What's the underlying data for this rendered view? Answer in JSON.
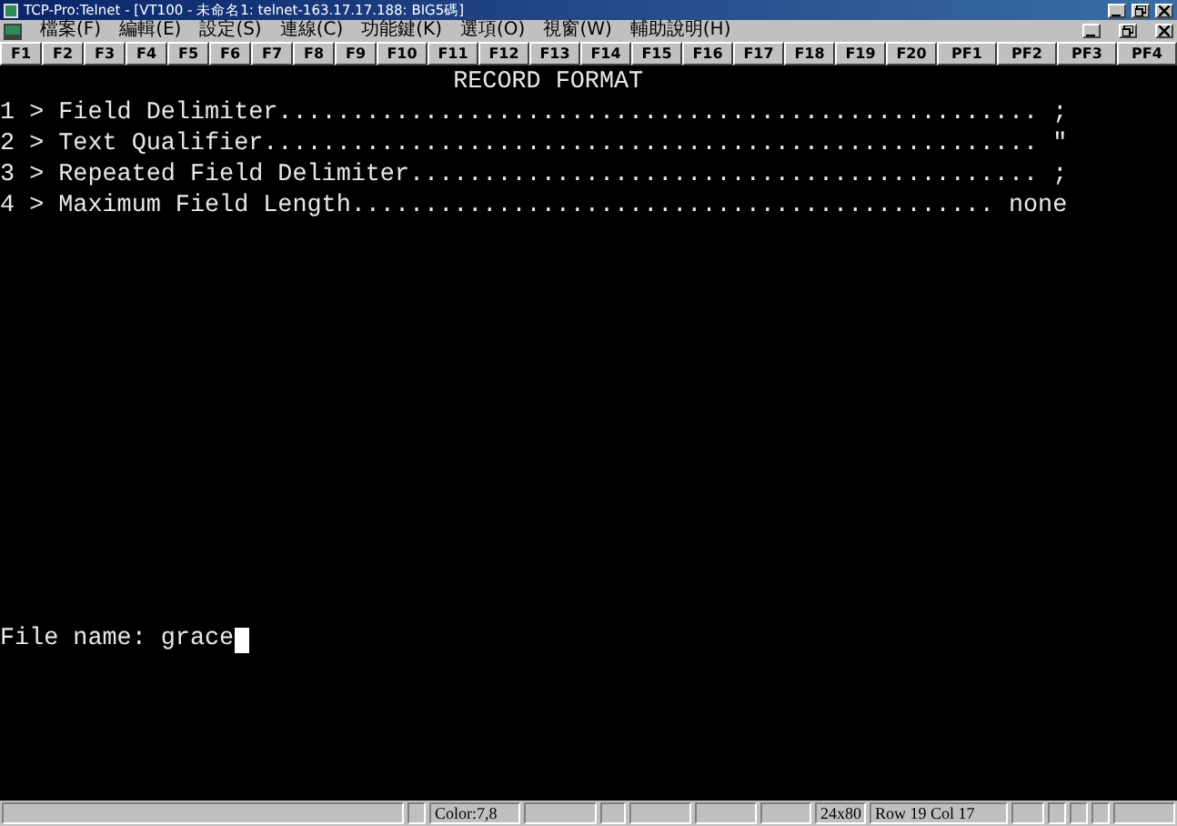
{
  "window": {
    "title": "TCP-Pro:Telnet - [VT100 - 未命名1: telnet-163.17.17.188: BIG5碼]"
  },
  "menu": [
    "檔案(F)",
    "編輯(E)",
    "設定(S)",
    "連線(C)",
    "功能鍵(K)",
    "選項(O)",
    "視窗(W)",
    "輔助說明(H)"
  ],
  "function_keys": [
    "F1",
    "F2",
    "F3",
    "F4",
    "F5",
    "F6",
    "F7",
    "F8",
    "F9",
    "F10",
    "F11",
    "F12",
    "F13",
    "F14",
    "F15",
    "F16",
    "F17",
    "F18",
    "F19",
    "F20",
    "PF1",
    "PF2",
    "PF3",
    "PF4"
  ],
  "terminal": {
    "heading": "RECORD FORMAT",
    "options": [
      {
        "text": "1 > Field Delimiter....................................................",
        "value": ";"
      },
      {
        "text": "2 > Text Qualifier.....................................................",
        "value": "\""
      },
      {
        "text": "3 > Repeated Field Delimiter...........................................",
        "value": ";"
      },
      {
        "text": "4 > Maximum Field Length............................................",
        "value": "none"
      }
    ],
    "prompt": "File name: grace"
  },
  "status_bar": {
    "color_setting": "Color:7,8",
    "size": "24x80",
    "position": "Row 19 Col 17"
  }
}
